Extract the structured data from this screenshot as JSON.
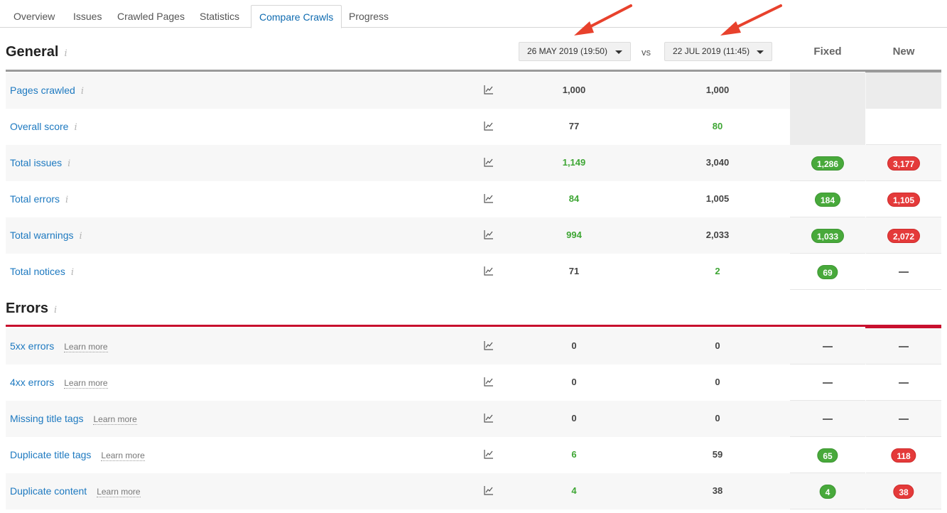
{
  "tabs": [
    "Overview",
    "Issues",
    "Crawled Pages",
    "Statistics",
    "Compare Crawls",
    "Progress"
  ],
  "active_tab": "Compare Crawls",
  "general": {
    "title": "General",
    "info": "i",
    "date_a": "26 MAY 2019 (19:50)",
    "vs": "vs",
    "date_b": "22 JUL 2019 (11:45)",
    "col_fixed": "Fixed",
    "col_new": "New",
    "rows": [
      {
        "label": "Pages crawled",
        "v1": "1,000",
        "v2": "1,000",
        "fixed": "",
        "new": "",
        "gray": true
      },
      {
        "label": "Overall score",
        "v1": "77",
        "v2": "80",
        "fixed": "",
        "new": "",
        "gray_fixed_only": true
      },
      {
        "label": "Total issues",
        "v1": "1,149",
        "v2": "3,040",
        "fixed": "1,286",
        "new": "3,177"
      },
      {
        "label": "Total errors",
        "v1": "84",
        "v2": "1,005",
        "fixed": "184",
        "new": "1,105"
      },
      {
        "label": "Total warnings",
        "v1": "994",
        "v2": "2,033",
        "fixed": "1,033",
        "new": "2,072"
      },
      {
        "label": "Total notices",
        "v1": "71",
        "v2": "2",
        "fixed": "69",
        "new": "—"
      }
    ]
  },
  "errors": {
    "title": "Errors",
    "info": "i",
    "learn_more": "Learn more",
    "rows": [
      {
        "label": "5xx errors",
        "v1": "0",
        "v2": "0",
        "fixed": "—",
        "new": "—"
      },
      {
        "label": "4xx errors",
        "v1": "0",
        "v2": "0",
        "fixed": "—",
        "new": "—"
      },
      {
        "label": "Missing title tags",
        "v1": "0",
        "v2": "0",
        "fixed": "—",
        "new": "—"
      },
      {
        "label": "Duplicate title tags",
        "v1": "6",
        "v2": "59",
        "fixed": "65",
        "new": "118"
      },
      {
        "label": "Duplicate content",
        "v1": "4",
        "v2": "38",
        "fixed": "4",
        "new": "38"
      }
    ]
  },
  "colors": {
    "link": "#1d79c0",
    "green": "#48a93b",
    "red": "#e43a3a",
    "error_rule": "#c8102e",
    "arrow": "#e8412c"
  }
}
